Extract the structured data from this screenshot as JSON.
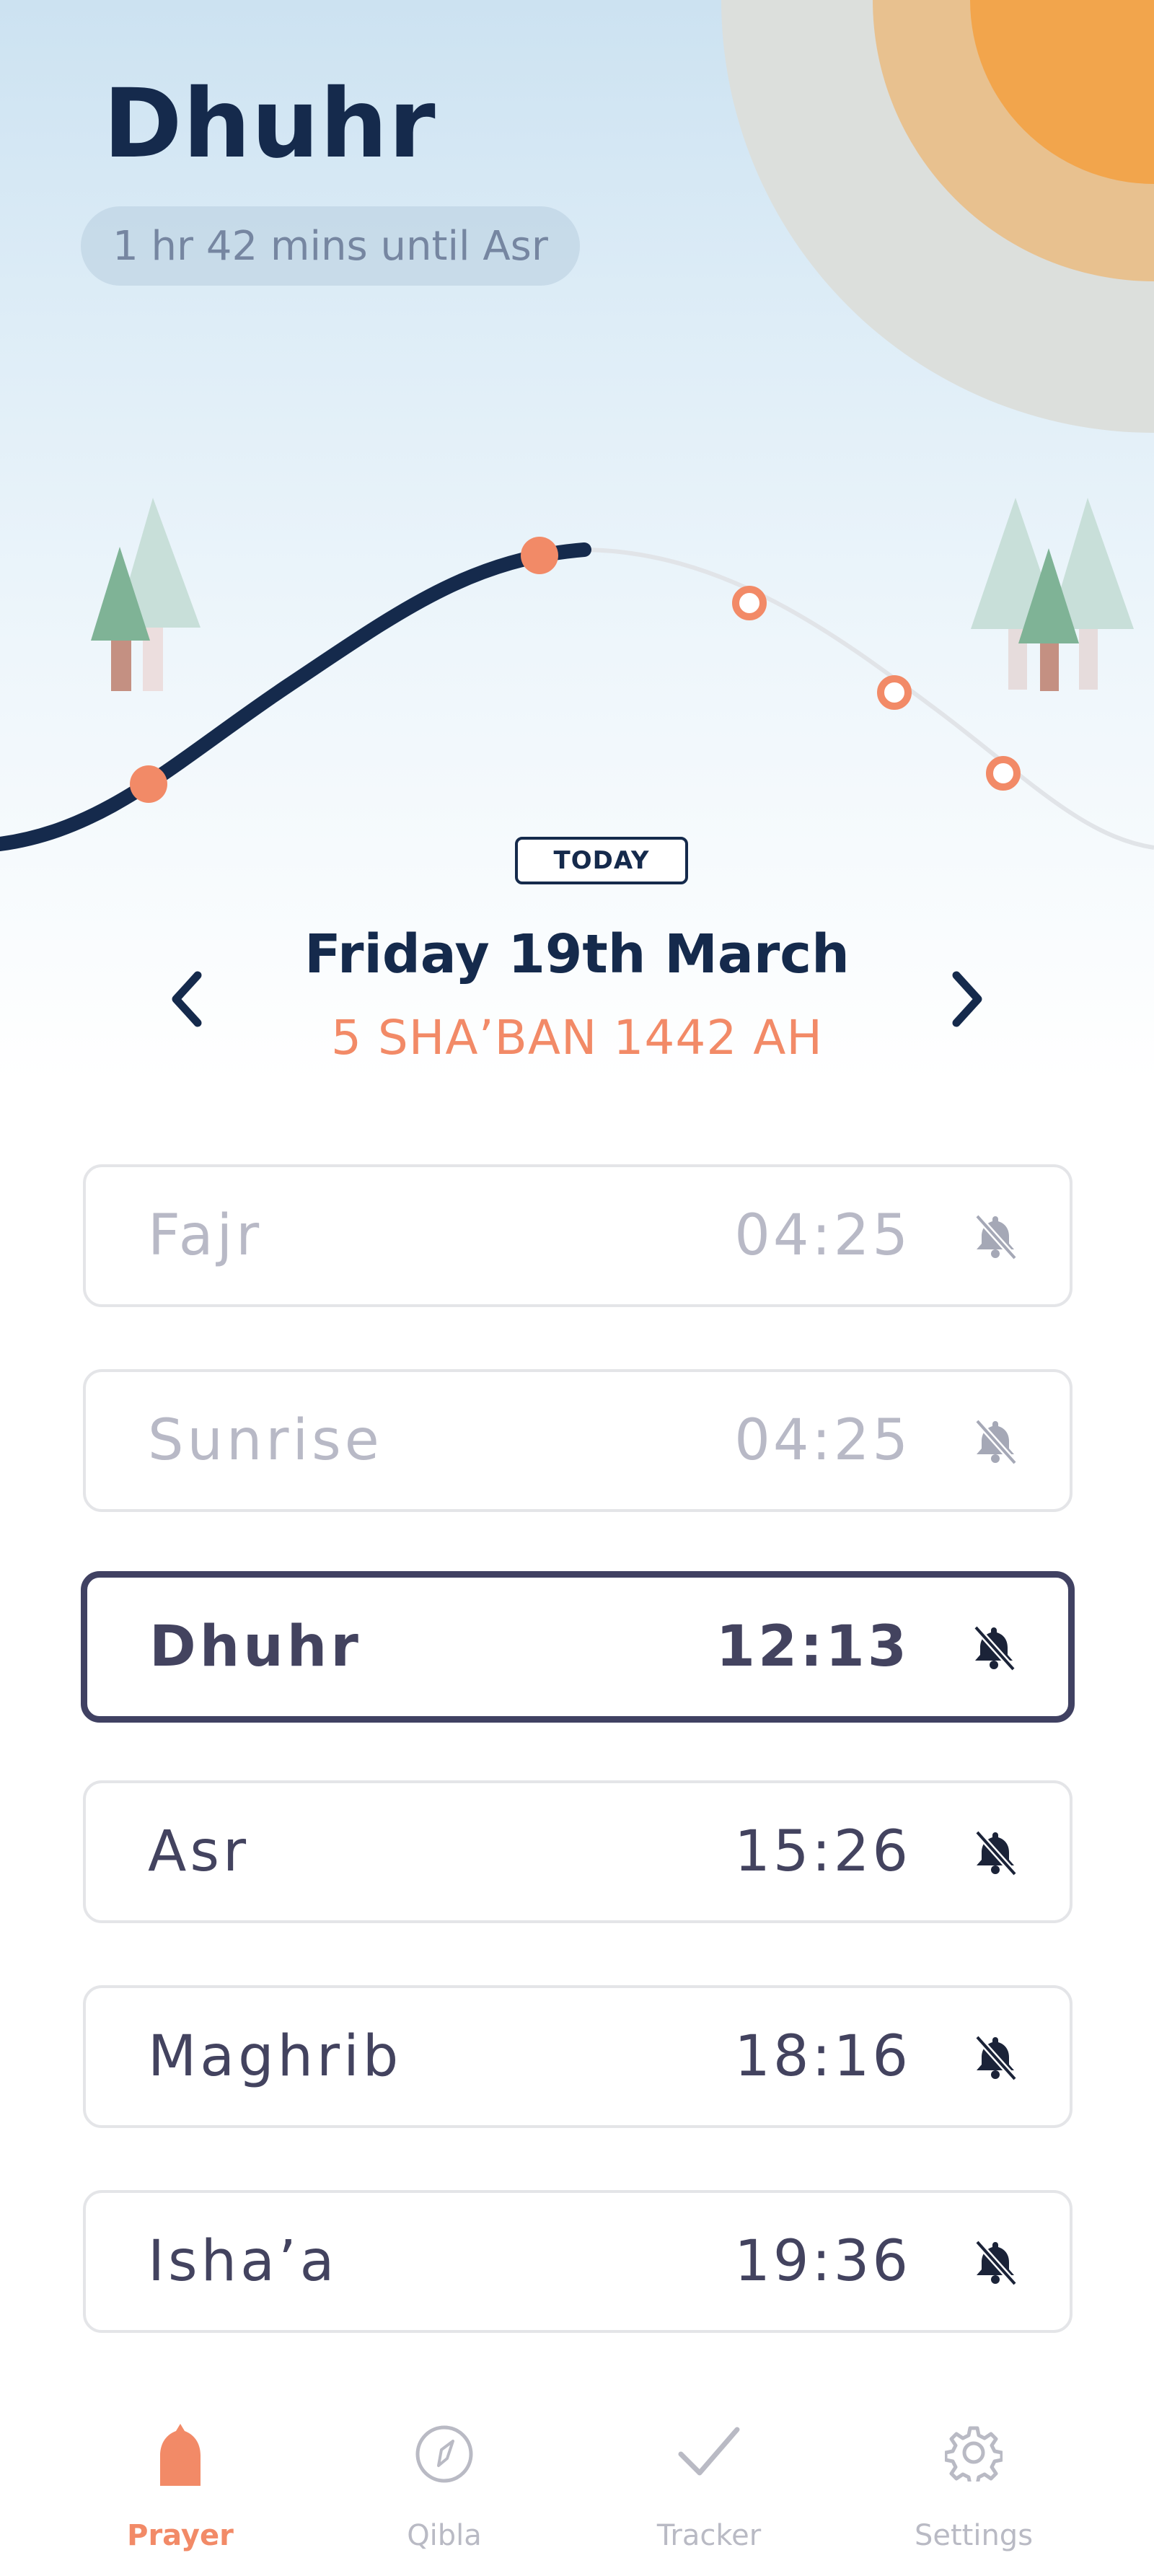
{
  "header": {
    "current_prayer": "Dhuhr",
    "countdown": "1 hr 42 mins until Asr"
  },
  "date": {
    "badge": "TODAY",
    "gregorian": "Friday 19th March",
    "hijri": "5 SHA’BAN 1442 AH"
  },
  "prayers": [
    {
      "name": "Fajr",
      "time": "04:25",
      "state": "past",
      "bell_icon": "bell-off-icon"
    },
    {
      "name": "Sunrise",
      "time": "04:25",
      "state": "past",
      "bell_icon": "bell-off-icon"
    },
    {
      "name": "Dhuhr",
      "time": "12:13",
      "state": "current",
      "bell_icon": "bell-off-icon"
    },
    {
      "name": "Asr",
      "time": "15:26",
      "state": "upcoming",
      "bell_icon": "bell-off-icon"
    },
    {
      "name": "Maghrib",
      "time": "18:16",
      "state": "upcoming",
      "bell_icon": "bell-off-icon"
    },
    {
      "name": "Isha’a",
      "time": "19:36",
      "state": "upcoming",
      "bell_icon": "bell-off-icon"
    }
  ],
  "tabs": [
    {
      "label": "Prayer",
      "icon": "mosque-icon",
      "active": true
    },
    {
      "label": "Qibla",
      "icon": "compass-icon",
      "active": false
    },
    {
      "label": "Tracker",
      "icon": "checkmark-icon",
      "active": false
    },
    {
      "label": "Settings",
      "icon": "gear-icon",
      "active": false
    }
  ],
  "colors": {
    "navy": "#152a4c",
    "accent": "#f28a67",
    "sun": "#f2a54c",
    "current_border": "#404162",
    "muted_text": "#b8b9c6"
  }
}
